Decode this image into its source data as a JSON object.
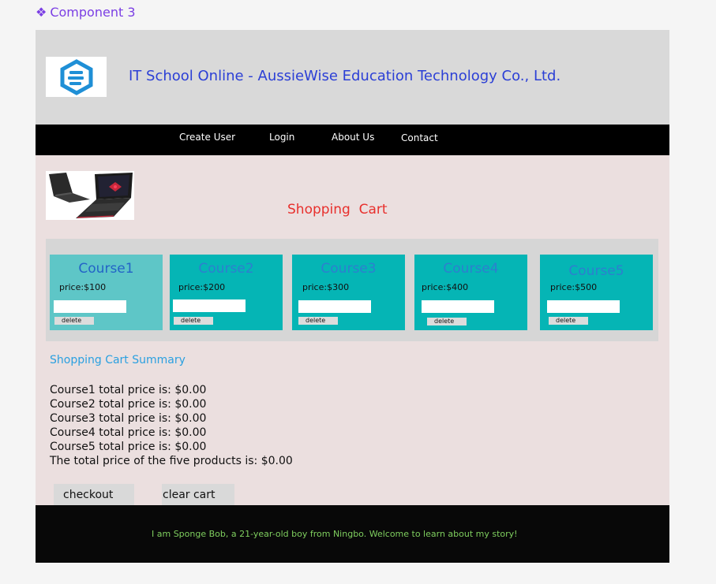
{
  "component_label": "Component 3",
  "header": {
    "title": "IT School Online - AussieWise Education Technology Co., Ltd."
  },
  "nav": {
    "items": [
      {
        "label": "Create User"
      },
      {
        "label": "Login"
      },
      {
        "label": "About Us"
      },
      {
        "label": "Contact"
      }
    ]
  },
  "cart": {
    "title": "Shopping  Cart",
    "courses": [
      {
        "name": "Course1",
        "price": "price:$100",
        "delete_label": "delete"
      },
      {
        "name": "Course2",
        "price": "price:$200",
        "delete_label": "delete"
      },
      {
        "name": "Course3",
        "price": "price:$300",
        "delete_label": "delete"
      },
      {
        "name": "Course4",
        "price": "price:$400",
        "delete_label": "delete"
      },
      {
        "name": "Course5",
        "price": "price:$500",
        "delete_label": "delete"
      }
    ]
  },
  "summary": {
    "title": "Shopping Cart Summary",
    "lines": [
      "Course1 total price is: $0.00",
      "Course2 total price is: $0.00",
      "Course3 total price is: $0.00",
      "Course4 total price is: $0.00",
      "Course5 total price is: $0.00",
      "The total price of the five products is: $0.00"
    ]
  },
  "actions": {
    "checkout_label": "checkout",
    "clear_label": "clear cart"
  },
  "footer": {
    "text": "I am Sponge Bob, a 21-year-old boy from Ningbo. Welcome to learn about my story!"
  },
  "colors": {
    "accent": "#7b3fe4",
    "header_title": "#2b3fd6",
    "cart_title": "#e8302d",
    "course_card": "#05b5b5",
    "summary_title": "#2aa0e0",
    "footer_text": "#7fcf5f"
  }
}
